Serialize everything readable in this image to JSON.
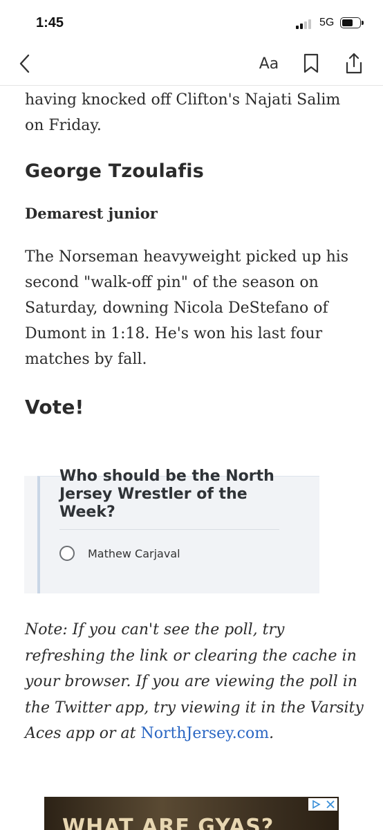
{
  "status_bar": {
    "time": "1:45",
    "network": "5G",
    "battery_level": 0.62
  },
  "toolbar": {
    "back_icon": "chevron-left-icon",
    "font_label": "Aa",
    "bookmark_icon": "bookmark-icon",
    "share_icon": "share-icon"
  },
  "article": {
    "intro_paragraph": "having knocked off Clifton's Najati Salim on Friday.",
    "athlete_name": "George Tzoulafis",
    "athlete_subtitle": "Demarest junior",
    "athlete_paragraph": "The Norseman heavyweight picked up his second \"walk-off pin\" of the season on Saturday, downing Nicola DeStefano of Dumont in 1:18. He's won his last four matches by fall.",
    "vote_heading": "Vote!"
  },
  "poll": {
    "question": "Who should be the North Jersey Wrestler of the Week?",
    "options": [
      {
        "label": "Mathew Carjaval"
      }
    ]
  },
  "note": {
    "text": "Note: If you can't see the poll, try refreshing the link or clearing the cache in your browser. If you are viewing the poll in the Twitter app, try viewing it in the Varsity Aces app or at ",
    "link_text": "NorthJersey.com",
    "trailing": "."
  },
  "ad": {
    "headline": "WHAT ARE GYAS?"
  },
  "colors": {
    "link": "#2a66c3",
    "poll_border": "#c9d6e6",
    "text": "#2b2b2b"
  }
}
